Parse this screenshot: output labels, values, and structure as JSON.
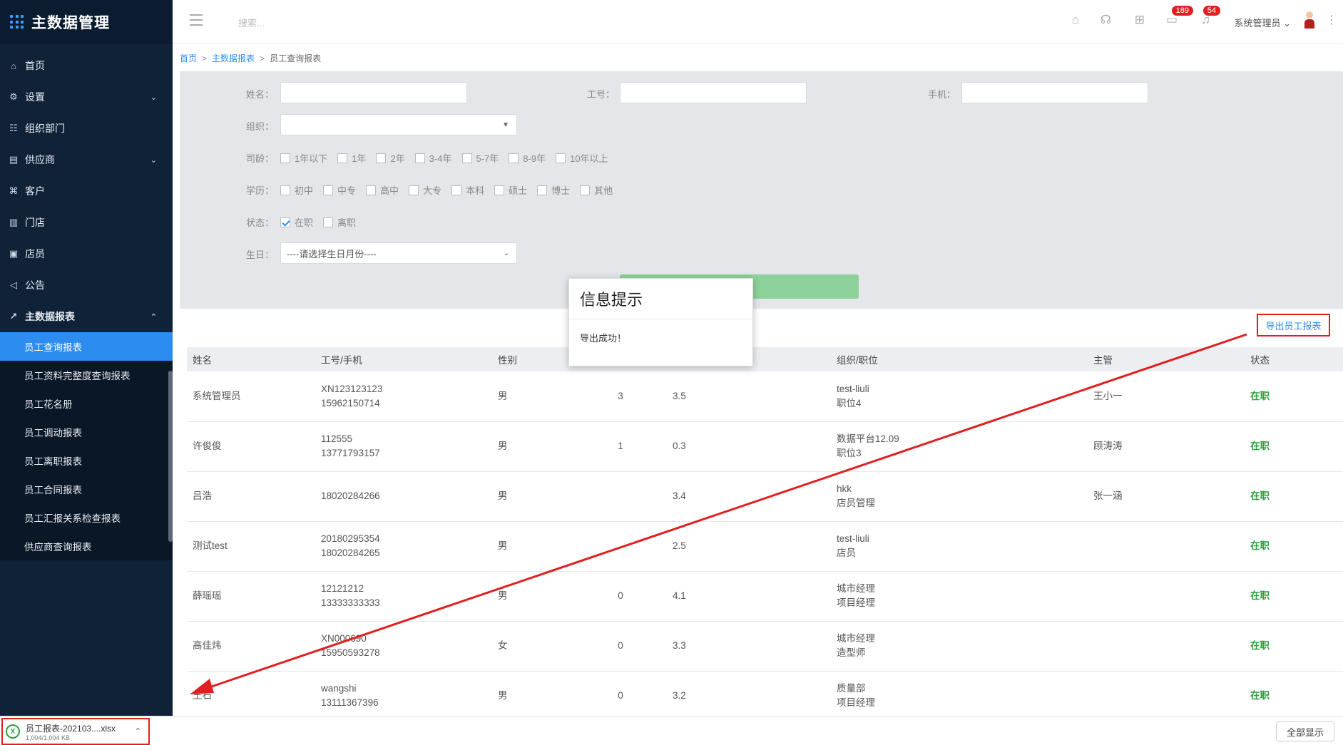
{
  "brand": {
    "title": "主数据管理"
  },
  "sidebar": {
    "items": [
      {
        "label": "首页",
        "icon": "home-icon",
        "glyph": "⌂",
        "caret": ""
      },
      {
        "label": "设置",
        "icon": "gear-icon",
        "glyph": "⚙",
        "caret": "⌄"
      },
      {
        "label": "组织部门",
        "icon": "org-icon",
        "glyph": "☷",
        "caret": ""
      },
      {
        "label": "供应商",
        "icon": "supplier-icon",
        "glyph": "▤",
        "caret": "⌄"
      },
      {
        "label": "客户",
        "icon": "customer-icon",
        "glyph": "⌘",
        "caret": ""
      },
      {
        "label": "门店",
        "icon": "store-icon",
        "glyph": "▥",
        "caret": ""
      },
      {
        "label": "店员",
        "icon": "clerk-icon",
        "glyph": "▣",
        "caret": ""
      },
      {
        "label": "公告",
        "icon": "notice-icon",
        "glyph": "◁",
        "caret": ""
      },
      {
        "label": "主数据报表",
        "icon": "chart-icon",
        "glyph": "↗",
        "caret": "⌃"
      }
    ],
    "submenu": [
      "员工查询报表",
      "员工资料完整度查询报表",
      "员工花名册",
      "员工调动报表",
      "员工离职报表",
      "员工合同报表",
      "员工汇报关系检查报表",
      "供应商查询报表"
    ]
  },
  "header": {
    "search_placeholder": "搜索...",
    "badge_messages": "189",
    "badge_notifications": "54",
    "user_name": "系统管理员"
  },
  "breadcrumb": {
    "home": "首页",
    "level1": "主数据报表",
    "current": "员工查询报表"
  },
  "filter": {
    "name_label": "姓名：",
    "id_label": "工号：",
    "phone_label": "手机：",
    "org_label": "组织：",
    "tenure_label": "司龄：",
    "tenure_options": [
      "1年以下",
      "1年",
      "2年",
      "3-4年",
      "5-7年",
      "8-9年",
      "10年以上"
    ],
    "edu_label": "学历：",
    "edu_options": [
      "初中",
      "中专",
      "高中",
      "大专",
      "本科",
      "硕士",
      "博士",
      "其他"
    ],
    "status_label": "状态：",
    "status_options": [
      "在职",
      "离职"
    ],
    "birthday_label": "生日：",
    "birthday_placeholder": "----请选择生日月份----"
  },
  "export_label": "导出员工报表",
  "table": {
    "headers": [
      "姓名",
      "工号/手机",
      "性别",
      "",
      "司龄",
      "组织/职位",
      "主管",
      "状态"
    ],
    "rows": [
      {
        "name": "系统管理员",
        "id": "XN123123123",
        "phone": "15962150714",
        "gender": "男",
        "col4": "3",
        "tenure": "3.5",
        "org": "test-liuli",
        "pos": "职位4",
        "manager": "王小一",
        "status": "在职"
      },
      {
        "name": "许俊俊",
        "id": "112555",
        "phone": "13771793157",
        "gender": "男",
        "col4": "1",
        "tenure": "0.3",
        "org": "数据平台12.09",
        "pos": "职位3",
        "manager": "顾涛涛",
        "status": "在职"
      },
      {
        "name": "吕浩",
        "id": "",
        "phone": "18020284266",
        "gender": "男",
        "col4": "",
        "tenure": "3.4",
        "org": "hkk",
        "pos": "店员管理",
        "manager": "张一涵",
        "status": "在职"
      },
      {
        "name": "测试test",
        "id": "20180295354",
        "phone": "18020284265",
        "gender": "男",
        "col4": "",
        "tenure": "2.5",
        "org": "test-liuli",
        "pos": "店员",
        "manager": "",
        "status": "在职"
      },
      {
        "name": "薛瑶瑶",
        "id": "12121212",
        "phone": "13333333333",
        "gender": "男",
        "col4": "0",
        "tenure": "4.1",
        "org": "城市经理",
        "pos": "项目经理",
        "manager": "",
        "status": "在职"
      },
      {
        "name": "高佳炜",
        "id": "XN000690",
        "phone": "15950593278",
        "gender": "女",
        "col4": "0",
        "tenure": "3.3",
        "org": "城市经理",
        "pos": "造型师",
        "manager": "",
        "status": "在职"
      },
      {
        "name": "王石",
        "id": "wangshi",
        "phone": "13111367396",
        "gender": "男",
        "col4": "0",
        "tenure": "3.2",
        "org": "质量部",
        "pos": "项目经理",
        "manager": "",
        "status": "在职"
      }
    ]
  },
  "modal": {
    "title": "信息提示",
    "message": "导出成功！"
  },
  "download": {
    "filename": "员工报表-202103....xlsx",
    "size": "1,004/1,004 KB",
    "show_all": "全部显示"
  },
  "colors": {
    "sidebar": "#0f2238",
    "accent": "#2d8cf0",
    "highlight_red": "#e02020",
    "status_green": "#2e9e3e"
  }
}
